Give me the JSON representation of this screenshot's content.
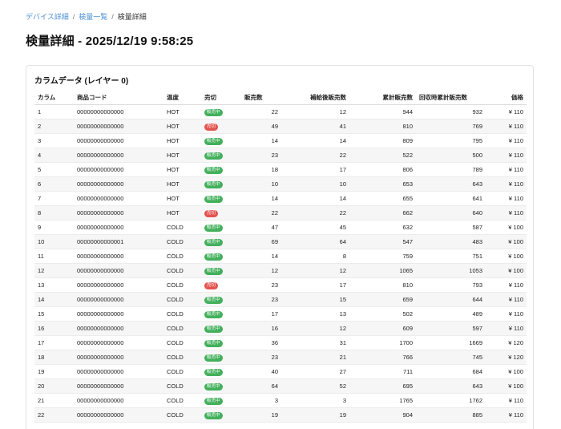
{
  "breadcrumb": {
    "items": [
      {
        "label": "デバイス詳細",
        "link": true
      },
      {
        "label": "検量一覧",
        "link": true
      },
      {
        "label": "検量詳細",
        "link": false
      }
    ],
    "separator": "/"
  },
  "page_title": "検量詳細 - 2025/12/19 9:58:25",
  "card": {
    "title": "カラムデータ (レイヤー 0)",
    "headers": [
      "カラム",
      "商品コード",
      "温度",
      "売切",
      "販売数",
      "補給後販売数",
      "累計販売数",
      "回収時累計販売数",
      "価格"
    ],
    "rows": [
      {
        "col": "1",
        "code": "00000000000000",
        "temp": "HOT",
        "status": "販売中",
        "sold_out": false,
        "sales": "22",
        "after": "12",
        "cum": "944",
        "rec": "932",
        "price": "¥ 110"
      },
      {
        "col": "2",
        "code": "00000000000000",
        "temp": "HOT",
        "status": "売切",
        "sold_out": true,
        "sales": "49",
        "after": "41",
        "cum": "810",
        "rec": "769",
        "price": "¥ 110"
      },
      {
        "col": "3",
        "code": "00000000000000",
        "temp": "HOT",
        "status": "販売中",
        "sold_out": false,
        "sales": "14",
        "after": "14",
        "cum": "809",
        "rec": "795",
        "price": "¥ 110"
      },
      {
        "col": "4",
        "code": "00000000000000",
        "temp": "HOT",
        "status": "販売中",
        "sold_out": false,
        "sales": "23",
        "after": "22",
        "cum": "522",
        "rec": "500",
        "price": "¥ 110"
      },
      {
        "col": "5",
        "code": "00000000000000",
        "temp": "HOT",
        "status": "販売中",
        "sold_out": false,
        "sales": "18",
        "after": "17",
        "cum": "806",
        "rec": "789",
        "price": "¥ 110"
      },
      {
        "col": "6",
        "code": "00000000000000",
        "temp": "HOT",
        "status": "販売中",
        "sold_out": false,
        "sales": "10",
        "after": "10",
        "cum": "653",
        "rec": "643",
        "price": "¥ 110"
      },
      {
        "col": "7",
        "code": "00000000000000",
        "temp": "HOT",
        "status": "販売中",
        "sold_out": false,
        "sales": "14",
        "after": "14",
        "cum": "655",
        "rec": "641",
        "price": "¥ 110"
      },
      {
        "col": "8",
        "code": "00000000000000",
        "temp": "HOT",
        "status": "売切",
        "sold_out": true,
        "sales": "22",
        "after": "22",
        "cum": "662",
        "rec": "640",
        "price": "¥ 110"
      },
      {
        "col": "9",
        "code": "00000000000000",
        "temp": "COLD",
        "status": "販売中",
        "sold_out": false,
        "sales": "47",
        "after": "45",
        "cum": "632",
        "rec": "587",
        "price": "¥ 100"
      },
      {
        "col": "10",
        "code": "00000000000001",
        "temp": "COLD",
        "status": "販売中",
        "sold_out": false,
        "sales": "69",
        "after": "64",
        "cum": "547",
        "rec": "483",
        "price": "¥ 100"
      },
      {
        "col": "11",
        "code": "00000000000000",
        "temp": "COLD",
        "status": "販売中",
        "sold_out": false,
        "sales": "14",
        "after": "8",
        "cum": "759",
        "rec": "751",
        "price": "¥ 100"
      },
      {
        "col": "12",
        "code": "00000000000000",
        "temp": "COLD",
        "status": "販売中",
        "sold_out": false,
        "sales": "12",
        "after": "12",
        "cum": "1065",
        "rec": "1053",
        "price": "¥ 100"
      },
      {
        "col": "13",
        "code": "00000000000000",
        "temp": "COLD",
        "status": "売切",
        "sold_out": true,
        "sales": "23",
        "after": "17",
        "cum": "810",
        "rec": "793",
        "price": "¥ 110"
      },
      {
        "col": "14",
        "code": "00000000000000",
        "temp": "COLD",
        "status": "販売中",
        "sold_out": false,
        "sales": "23",
        "after": "15",
        "cum": "659",
        "rec": "644",
        "price": "¥ 110"
      },
      {
        "col": "15",
        "code": "00000000000000",
        "temp": "COLD",
        "status": "販売中",
        "sold_out": false,
        "sales": "17",
        "after": "13",
        "cum": "502",
        "rec": "489",
        "price": "¥ 110"
      },
      {
        "col": "16",
        "code": "00000000000000",
        "temp": "COLD",
        "status": "販売中",
        "sold_out": false,
        "sales": "16",
        "after": "12",
        "cum": "609",
        "rec": "597",
        "price": "¥ 110"
      },
      {
        "col": "17",
        "code": "00000000000000",
        "temp": "COLD",
        "status": "販売中",
        "sold_out": false,
        "sales": "36",
        "after": "31",
        "cum": "1700",
        "rec": "1669",
        "price": "¥ 120"
      },
      {
        "col": "18",
        "code": "00000000000000",
        "temp": "COLD",
        "status": "販売中",
        "sold_out": false,
        "sales": "23",
        "after": "21",
        "cum": "766",
        "rec": "745",
        "price": "¥ 120"
      },
      {
        "col": "19",
        "code": "00000000000000",
        "temp": "COLD",
        "status": "販売中",
        "sold_out": false,
        "sales": "40",
        "after": "27",
        "cum": "711",
        "rec": "684",
        "price": "¥ 100"
      },
      {
        "col": "20",
        "code": "00000000000000",
        "temp": "COLD",
        "status": "販売中",
        "sold_out": false,
        "sales": "64",
        "after": "52",
        "cum": "695",
        "rec": "643",
        "price": "¥ 100"
      },
      {
        "col": "21",
        "code": "00000000000000",
        "temp": "COLD",
        "status": "販売中",
        "sold_out": false,
        "sales": "3",
        "after": "3",
        "cum": "1765",
        "rec": "1762",
        "price": "¥ 110"
      },
      {
        "col": "22",
        "code": "00000000000000",
        "temp": "COLD",
        "status": "販売中",
        "sold_out": false,
        "sales": "19",
        "after": "19",
        "cum": "904",
        "rec": "885",
        "price": "¥ 110"
      }
    ]
  },
  "colors": {
    "link": "#4a8fd6",
    "badge_on": "#43b05c",
    "badge_off": "#e4544f"
  }
}
